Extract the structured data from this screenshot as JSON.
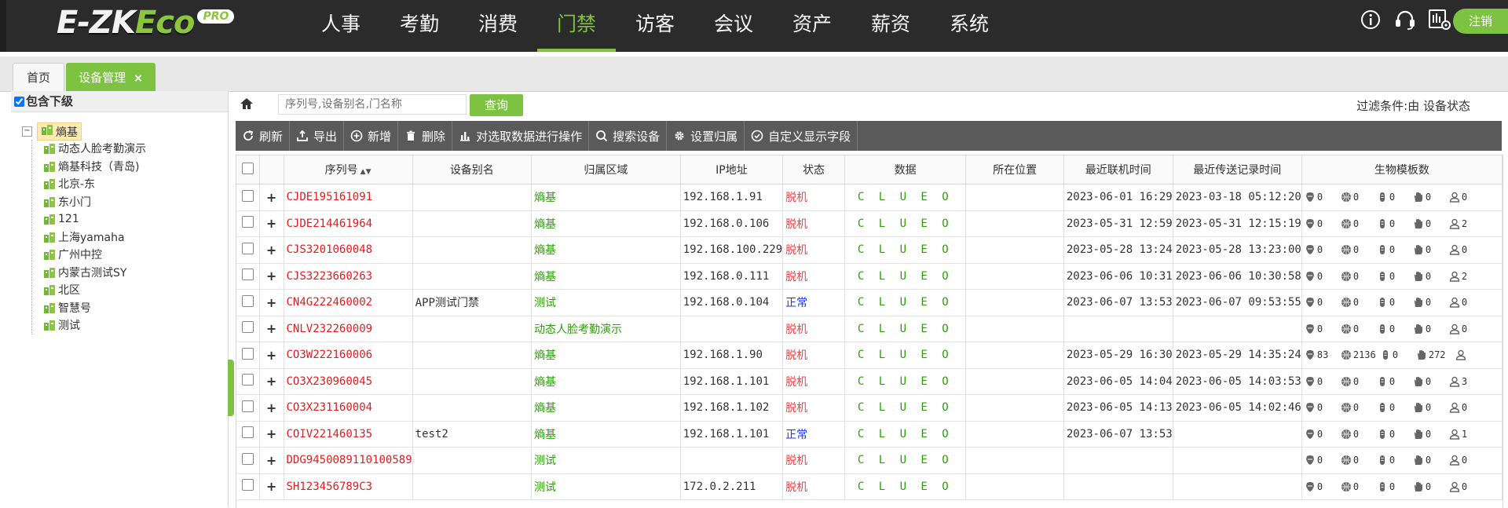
{
  "app": {
    "logo_main": "E-ZK",
    "logo_eco": "Eco",
    "logo_badge": "PRO",
    "logout": "注销"
  },
  "nav": [
    "人事",
    "考勤",
    "消费",
    "门禁",
    "访客",
    "会议",
    "资产",
    "薪资",
    "系统"
  ],
  "nav_active_index": 3,
  "tabs": {
    "home": "首页",
    "device": "设备管理",
    "close": "×"
  },
  "tree": {
    "include_sub": "包含下级",
    "root": "熵基",
    "children": [
      "动态人脸考勤演示",
      "熵基科技（青岛)",
      "北京-东",
      "东小门",
      "121",
      "上海yamaha",
      "广州中控",
      "内蒙古测试SY",
      "北区",
      "智慧号",
      "测试"
    ]
  },
  "search": {
    "placeholder": "序列号,设备别名,门名称",
    "button": "查询",
    "filter": "过滤条件:由 设备状态"
  },
  "toolbar": [
    "刷新",
    "导出",
    "新增",
    "删除",
    "对选取数据进行操作",
    "搜索设备",
    "设置归属",
    "自定义显示字段"
  ],
  "columns": [
    "序列号",
    "设备别名",
    "归属区域",
    "IP地址",
    "状态",
    "数据",
    "所在位置",
    "最近联机时间",
    "最近传送记录时间",
    "生物模板数"
  ],
  "rows": [
    {
      "sn": "CJDE195161091",
      "alias": "",
      "area": "熵基",
      "ip": "192.168.1.91",
      "status": "脱机",
      "data": "C L U E O",
      "loc": "",
      "online": "2023-06-01 16:29",
      "record": "2023-03-18 05:12:20",
      "bio": [
        "0",
        "0",
        "0",
        "0",
        "0"
      ]
    },
    {
      "sn": "CJDE214461964",
      "alias": "",
      "area": "熵基",
      "ip": "192.168.0.106",
      "status": "脱机",
      "data": "C L U E O",
      "loc": "",
      "online": "2023-05-31 12:59",
      "record": "2023-05-31 12:15:19",
      "bio": [
        "0",
        "0",
        "0",
        "0",
        "2"
      ]
    },
    {
      "sn": "CJS3201060048",
      "alias": "",
      "area": "熵基",
      "ip": "192.168.100.229",
      "status": "脱机",
      "data": "C L U E O",
      "loc": "",
      "online": "2023-05-28 13:24",
      "record": "2023-05-28 13:23:00",
      "bio": [
        "0",
        "0",
        "0",
        "0",
        "0"
      ]
    },
    {
      "sn": "CJS3223660263",
      "alias": "",
      "area": "熵基",
      "ip": "192.168.0.111",
      "status": "脱机",
      "data": "C L U E O",
      "loc": "",
      "online": "2023-06-06 10:31",
      "record": "2023-06-06 10:30:58",
      "bio": [
        "0",
        "0",
        "0",
        "0",
        "2"
      ]
    },
    {
      "sn": "CN4G222460002",
      "alias": "APP测试门禁",
      "area": "测试",
      "ip": "192.168.0.104",
      "status": "正常",
      "data": "C L U E O",
      "loc": "",
      "online": "2023-06-07 13:53",
      "record": "2023-06-07 09:53:55",
      "bio": [
        "0",
        "0",
        "0",
        "0",
        "0"
      ]
    },
    {
      "sn": "CNLV232260009",
      "alias": "",
      "area": "动态人脸考勤演示",
      "ip": "",
      "status": "脱机",
      "data": "C L U E O",
      "loc": "",
      "online": "",
      "record": "",
      "bio": [
        "0",
        "0",
        "0",
        "0",
        "0"
      ]
    },
    {
      "sn": "CO3W222160006",
      "alias": "",
      "area": "熵基",
      "ip": "192.168.1.90",
      "status": "脱机",
      "data": "C L U E O",
      "loc": "",
      "online": "2023-05-29 16:30",
      "record": "2023-05-29 14:35:24",
      "bio": [
        "83",
        "2136",
        "0",
        "272",
        ""
      ]
    },
    {
      "sn": "CO3X230960045",
      "alias": "",
      "area": "熵基",
      "ip": "192.168.1.101",
      "status": "脱机",
      "data": "C L U E O",
      "loc": "",
      "online": "2023-06-05 14:04",
      "record": "2023-06-05 14:03:53",
      "bio": [
        "0",
        "0",
        "0",
        "0",
        "3"
      ]
    },
    {
      "sn": "CO3X231160004",
      "alias": "",
      "area": "熵基",
      "ip": "192.168.1.102",
      "status": "脱机",
      "data": "C L U E O",
      "loc": "",
      "online": "2023-06-05 14:13",
      "record": "2023-06-05 14:02:46",
      "bio": [
        "0",
        "0",
        "0",
        "0",
        "0"
      ]
    },
    {
      "sn": "COIV221460135",
      "alias": "test2",
      "area": "熵基",
      "ip": "192.168.1.101",
      "status": "正常",
      "data": "C L U E O",
      "loc": "",
      "online": "2023-06-07 13:53",
      "record": "",
      "bio": [
        "0",
        "0",
        "0",
        "0",
        "1"
      ]
    },
    {
      "sn": "DDG9450089110100589",
      "alias": "",
      "area": "测试",
      "ip": "",
      "status": "脱机",
      "data": "C L U E O",
      "loc": "",
      "online": "",
      "record": "",
      "bio": [
        "0",
        "0",
        "0",
        "0",
        "0"
      ]
    },
    {
      "sn": "SH123456789C3",
      "alias": "",
      "area": "测试",
      "ip": "172.0.2.211",
      "status": "脱机",
      "data": "C L U E O",
      "loc": "",
      "online": "",
      "record": "",
      "bio": [
        "0",
        "0",
        "0",
        "0",
        "0"
      ]
    }
  ],
  "icons": {
    "top": [
      "info-icon",
      "headset-icon",
      "device-settings-icon"
    ],
    "toolbar": [
      "refresh-icon",
      "export-icon",
      "add-icon",
      "delete-icon",
      "chart-icon",
      "search-icon",
      "gear-icon",
      "check-circle-icon"
    ],
    "bio": [
      "face-icon",
      "palm-icon",
      "fingervein-icon",
      "hand-icon",
      "user-icon"
    ]
  },
  "colors": {
    "accent": "#7ec242",
    "offline": "#ee4444",
    "online": "#1c39e0",
    "serial": "#e31c1c",
    "area": "#2e9e0c"
  }
}
